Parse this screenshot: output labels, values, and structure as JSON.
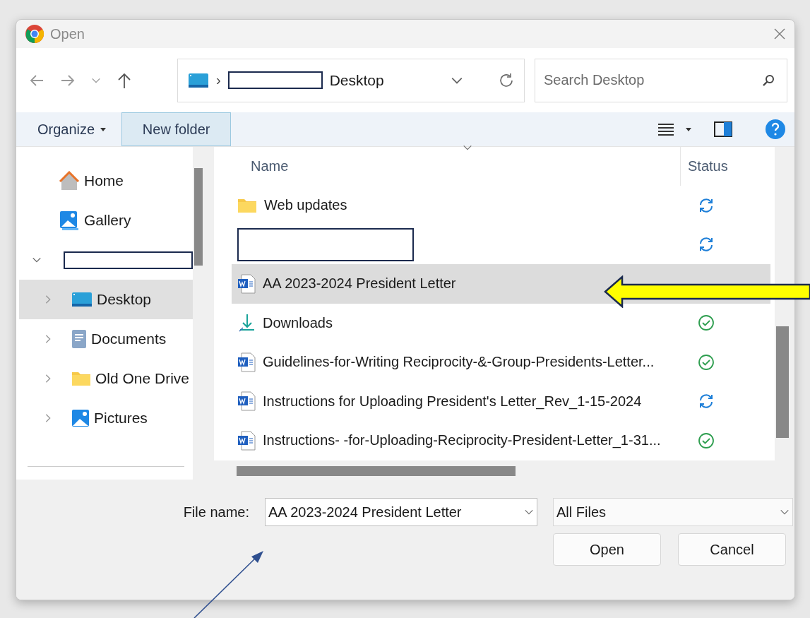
{
  "window": {
    "title": "Open"
  },
  "address": {
    "current": "Desktop",
    "separator": "›"
  },
  "search": {
    "placeholder": "Search Desktop"
  },
  "toolbar": {
    "organize": "Organize",
    "new_folder": "New folder"
  },
  "sidebar": {
    "items": [
      {
        "kind": "home",
        "label": "Home",
        "selected": false
      },
      {
        "kind": "gallery",
        "label": "Gallery",
        "selected": false
      },
      {
        "kind": "redacted",
        "expanded": true,
        "selected": false,
        "children": [
          {
            "kind": "desktop",
            "label": "Desktop",
            "selected": true
          },
          {
            "kind": "documents",
            "label": "Documents",
            "selected": false
          },
          {
            "kind": "folder",
            "label": "Old One Drive",
            "selected": false
          },
          {
            "kind": "pictures",
            "label": "Pictures",
            "selected": false
          }
        ]
      }
    ]
  },
  "table": {
    "columns": [
      "Name",
      "Status"
    ],
    "rows": [
      {
        "kind": "folder",
        "name": "Web updates",
        "synced": false,
        "selected": false
      },
      {
        "kind": "redacted",
        "synced": false,
        "selected": false
      },
      {
        "kind": "word",
        "name": "AA 2023-2024 President Letter",
        "selected": true
      },
      {
        "kind": "downloads",
        "name": "Downloads",
        "synced": true,
        "selected": false
      },
      {
        "kind": "word",
        "name": "Guidelines-for-Writing Reciprocity-&-Group-Presidents-Letter...",
        "synced": true,
        "selected": false
      },
      {
        "kind": "word",
        "name": "Instructions for Uploading President's Letter_Rev_1-15-2024",
        "synced": false,
        "selected": false
      },
      {
        "kind": "word",
        "name": "Instructions- -for-Uploading-Reciprocity-President-Letter_1-31...",
        "synced": true,
        "selected": false
      }
    ]
  },
  "footer": {
    "file_name_label": "File name:",
    "file_name": "AA 2023-2024 President Letter",
    "file_type": "All Files",
    "buttons": [
      "Open",
      "Cancel"
    ]
  }
}
